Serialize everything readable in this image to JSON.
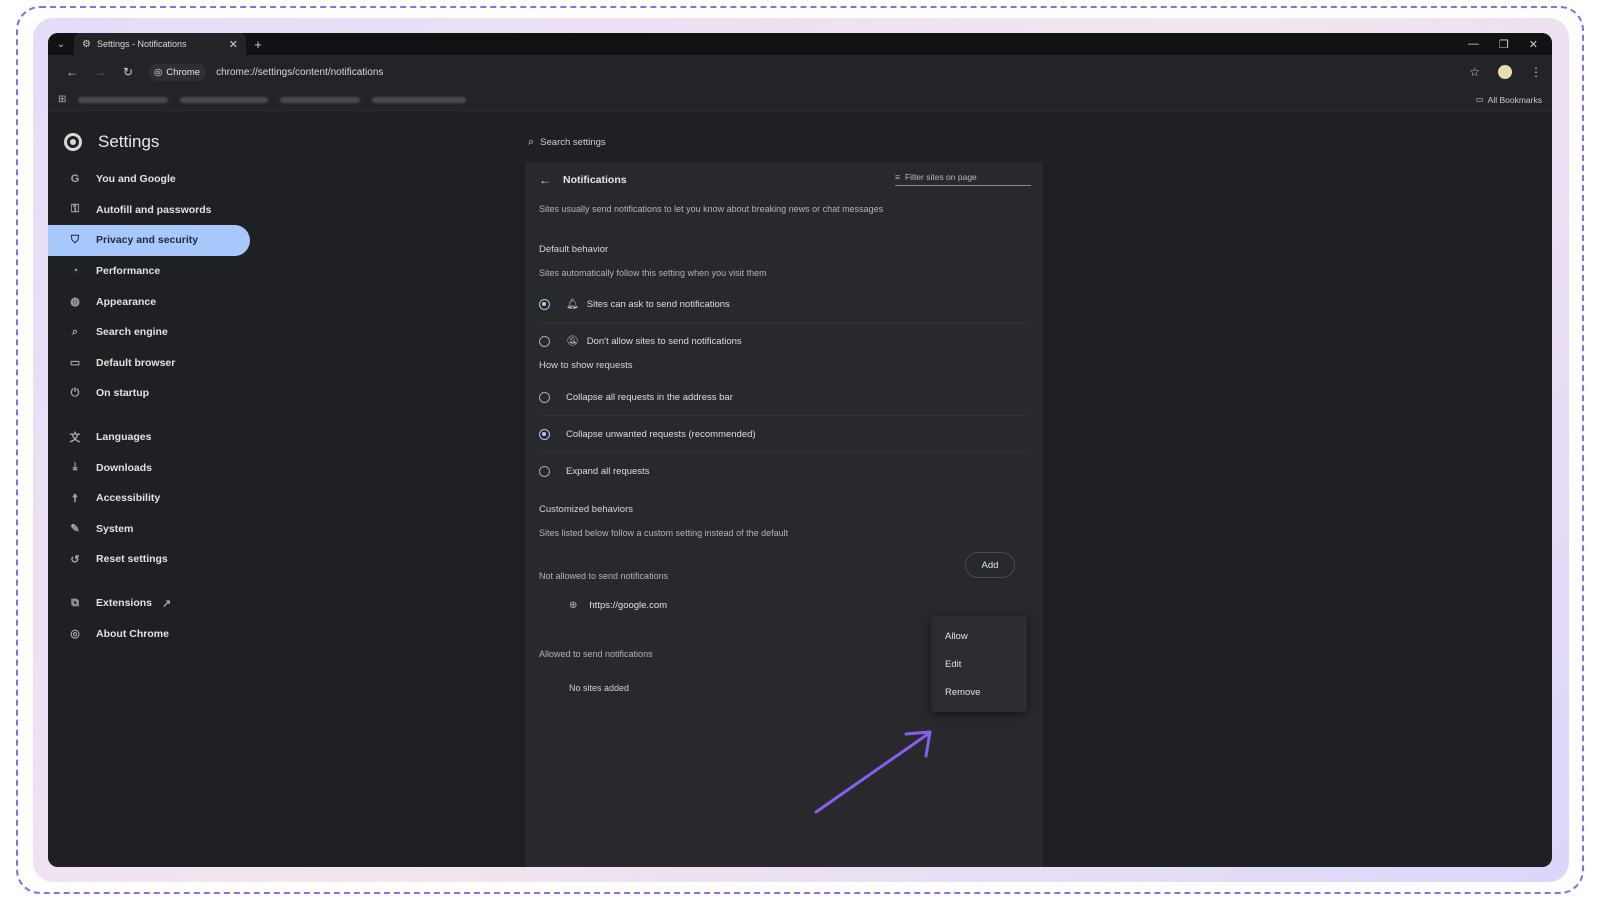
{
  "browser": {
    "tab_title": "Settings - Notifications",
    "new_tab": "+",
    "url_chip": "Chrome",
    "url": "chrome://settings/content/notifications",
    "all_bookmarks": "All Bookmarks"
  },
  "sidebar": {
    "title": "Settings",
    "items": [
      {
        "label": "You and Google",
        "icon": "google-icon"
      },
      {
        "label": "Autofill and passwords",
        "icon": "key-icon"
      },
      {
        "label": "Privacy and security",
        "icon": "shield-icon",
        "active": true
      },
      {
        "label": "Performance",
        "icon": "speedometer-icon"
      },
      {
        "label": "Appearance",
        "icon": "palette-icon"
      },
      {
        "label": "Search engine",
        "icon": "search-icon"
      },
      {
        "label": "Default browser",
        "icon": "browser-window-icon"
      },
      {
        "label": "On startup",
        "icon": "power-icon"
      },
      {
        "label": "Languages",
        "icon": "translate-icon"
      },
      {
        "label": "Downloads",
        "icon": "download-icon"
      },
      {
        "label": "Accessibility",
        "icon": "accessibility-icon"
      },
      {
        "label": "System",
        "icon": "wrench-icon"
      },
      {
        "label": "Reset settings",
        "icon": "reset-icon"
      },
      {
        "label": "Extensions",
        "icon": "puzzle-icon"
      },
      {
        "label": "About Chrome",
        "icon": "chrome-icon"
      }
    ]
  },
  "search": {
    "placeholder": "Search settings"
  },
  "notifications": {
    "title": "Notifications",
    "filter_placeholder": "Filter sites on page",
    "intro": "Sites usually send notifications to let you know about breaking news or chat messages",
    "default_behavior": {
      "title": "Default behavior",
      "desc": "Sites automatically follow this setting when you visit them",
      "options": [
        {
          "label": "Sites can ask to send notifications",
          "selected": true,
          "icon": "bell-icon"
        },
        {
          "label": "Don't allow sites to send notifications",
          "selected": false,
          "icon": "bell-off-icon"
        }
      ]
    },
    "requests": {
      "title": "How to show requests",
      "options": [
        {
          "label": "Collapse all requests in the address bar",
          "selected": false
        },
        {
          "label": "Collapse unwanted requests (recommended)",
          "selected": true
        },
        {
          "label": "Expand all requests",
          "selected": false
        }
      ]
    },
    "customized": {
      "title": "Customized behaviors",
      "desc": "Sites listed below follow a custom setting instead of the default",
      "not_allowed_title": "Not allowed to send notifications",
      "add_label": "Add",
      "blocked_sites": [
        "https://google.com"
      ],
      "allowed_title": "Allowed to send notifications",
      "no_sites": "No sites added"
    },
    "context_menu": [
      "Allow",
      "Edit",
      "Remove"
    ]
  },
  "colors": {
    "accent": "#a8c7fa",
    "annotation_arrow": "#8a5cf0"
  }
}
